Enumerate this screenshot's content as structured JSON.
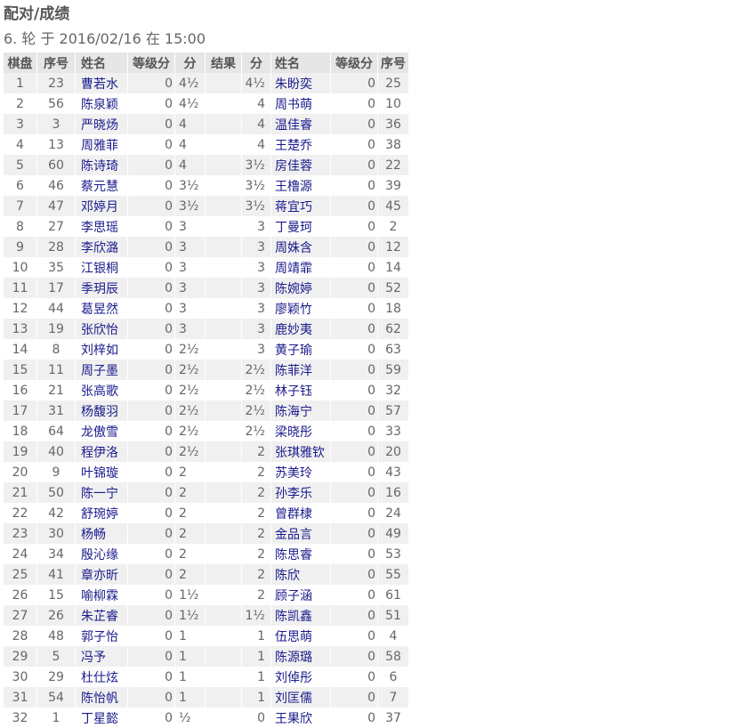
{
  "title": "配对/成绩",
  "round_info": "6. 轮 于 2016/02/16 在 15:00",
  "headers": {
    "board": "棋盘",
    "no1": "序号",
    "name1": "姓名",
    "rating1": "等级分",
    "pts1": "分",
    "result": "结果",
    "pts2": "分",
    "name2": "姓名",
    "rating2": "等级分",
    "no2": "序号"
  },
  "colors": {
    "header_bg": "#e6e6e6",
    "row_alt_bg": "#f0f0f0",
    "link": "#1a1a8c",
    "text": "#666666"
  },
  "rows": [
    {
      "board": "1",
      "no1": "23",
      "name1": "曹若水",
      "rating1": "0",
      "pts1": "4½",
      "result": "",
      "pts2": "4½",
      "name2": "朱盼奕",
      "rating2": "0",
      "no2": "25"
    },
    {
      "board": "2",
      "no1": "56",
      "name1": "陈泉颖",
      "rating1": "0",
      "pts1": "4½",
      "result": "",
      "pts2": "4",
      "name2": "周书萌",
      "rating2": "0",
      "no2": "10"
    },
    {
      "board": "3",
      "no1": "3",
      "name1": "严晓炀",
      "rating1": "0",
      "pts1": "4",
      "result": "",
      "pts2": "4",
      "name2": "温佳睿",
      "rating2": "0",
      "no2": "36"
    },
    {
      "board": "4",
      "no1": "13",
      "name1": "周雅菲",
      "rating1": "0",
      "pts1": "4",
      "result": "",
      "pts2": "4",
      "name2": "王楚乔",
      "rating2": "0",
      "no2": "38"
    },
    {
      "board": "5",
      "no1": "60",
      "name1": "陈诗琦",
      "rating1": "0",
      "pts1": "4",
      "result": "",
      "pts2": "3½",
      "name2": "房佳蓉",
      "rating2": "0",
      "no2": "22"
    },
    {
      "board": "6",
      "no1": "46",
      "name1": "蔡元慧",
      "rating1": "0",
      "pts1": "3½",
      "result": "",
      "pts2": "3½",
      "name2": "王橹源",
      "rating2": "0",
      "no2": "39"
    },
    {
      "board": "7",
      "no1": "47",
      "name1": "邓婷月",
      "rating1": "0",
      "pts1": "3½",
      "result": "",
      "pts2": "3½",
      "name2": "蒋宜巧",
      "rating2": "0",
      "no2": "45"
    },
    {
      "board": "8",
      "no1": "27",
      "name1": "李思瑶",
      "rating1": "0",
      "pts1": "3",
      "result": "",
      "pts2": "3",
      "name2": "丁曼珂",
      "rating2": "0",
      "no2": "2"
    },
    {
      "board": "9",
      "no1": "28",
      "name1": "李欣潞",
      "rating1": "0",
      "pts1": "3",
      "result": "",
      "pts2": "3",
      "name2": "周姝含",
      "rating2": "0",
      "no2": "12"
    },
    {
      "board": "10",
      "no1": "35",
      "name1": "江银桐",
      "rating1": "0",
      "pts1": "3",
      "result": "",
      "pts2": "3",
      "name2": "周靖霏",
      "rating2": "0",
      "no2": "14"
    },
    {
      "board": "11",
      "no1": "17",
      "name1": "季玥辰",
      "rating1": "0",
      "pts1": "3",
      "result": "",
      "pts2": "3",
      "name2": "陈婉婷",
      "rating2": "0",
      "no2": "52"
    },
    {
      "board": "12",
      "no1": "44",
      "name1": "葛昱然",
      "rating1": "0",
      "pts1": "3",
      "result": "",
      "pts2": "3",
      "name2": "廖颖竹",
      "rating2": "0",
      "no2": "18"
    },
    {
      "board": "13",
      "no1": "19",
      "name1": "张欣怡",
      "rating1": "0",
      "pts1": "3",
      "result": "",
      "pts2": "3",
      "name2": "鹿妙夷",
      "rating2": "0",
      "no2": "62"
    },
    {
      "board": "14",
      "no1": "8",
      "name1": "刘梓如",
      "rating1": "0",
      "pts1": "2½",
      "result": "",
      "pts2": "3",
      "name2": "黄子瑜",
      "rating2": "0",
      "no2": "63"
    },
    {
      "board": "15",
      "no1": "11",
      "name1": "周子墨",
      "rating1": "0",
      "pts1": "2½",
      "result": "",
      "pts2": "2½",
      "name2": "陈菲洋",
      "rating2": "0",
      "no2": "59"
    },
    {
      "board": "16",
      "no1": "21",
      "name1": "张高歌",
      "rating1": "0",
      "pts1": "2½",
      "result": "",
      "pts2": "2½",
      "name2": "林子钰",
      "rating2": "0",
      "no2": "32"
    },
    {
      "board": "17",
      "no1": "31",
      "name1": "杨馥羽",
      "rating1": "0",
      "pts1": "2½",
      "result": "",
      "pts2": "2½",
      "name2": "陈海宁",
      "rating2": "0",
      "no2": "57"
    },
    {
      "board": "18",
      "no1": "64",
      "name1": "龙傲雪",
      "rating1": "0",
      "pts1": "2½",
      "result": "",
      "pts2": "2½",
      "name2": "梁晓彤",
      "rating2": "0",
      "no2": "33"
    },
    {
      "board": "19",
      "no1": "40",
      "name1": "程伊洛",
      "rating1": "0",
      "pts1": "2½",
      "result": "",
      "pts2": "2",
      "name2": "张琪雅钦",
      "rating2": "0",
      "no2": "20"
    },
    {
      "board": "20",
      "no1": "9",
      "name1": "叶锦璇",
      "rating1": "0",
      "pts1": "2",
      "result": "",
      "pts2": "2",
      "name2": "苏美玲",
      "rating2": "0",
      "no2": "43"
    },
    {
      "board": "21",
      "no1": "50",
      "name1": "陈一宁",
      "rating1": "0",
      "pts1": "2",
      "result": "",
      "pts2": "2",
      "name2": "孙李乐",
      "rating2": "0",
      "no2": "16"
    },
    {
      "board": "22",
      "no1": "42",
      "name1": "舒琬婷",
      "rating1": "0",
      "pts1": "2",
      "result": "",
      "pts2": "2",
      "name2": "曾群棣",
      "rating2": "0",
      "no2": "24"
    },
    {
      "board": "23",
      "no1": "30",
      "name1": "杨畅",
      "rating1": "0",
      "pts1": "2",
      "result": "",
      "pts2": "2",
      "name2": "金品言",
      "rating2": "0",
      "no2": "49"
    },
    {
      "board": "24",
      "no1": "34",
      "name1": "殷沁缘",
      "rating1": "0",
      "pts1": "2",
      "result": "",
      "pts2": "2",
      "name2": "陈思睿",
      "rating2": "0",
      "no2": "53"
    },
    {
      "board": "25",
      "no1": "41",
      "name1": "章亦昕",
      "rating1": "0",
      "pts1": "2",
      "result": "",
      "pts2": "2",
      "name2": "陈欣",
      "rating2": "0",
      "no2": "55"
    },
    {
      "board": "26",
      "no1": "15",
      "name1": "喻柳霖",
      "rating1": "0",
      "pts1": "1½",
      "result": "",
      "pts2": "2",
      "name2": "顾子涵",
      "rating2": "0",
      "no2": "61"
    },
    {
      "board": "27",
      "no1": "26",
      "name1": "朱芷睿",
      "rating1": "0",
      "pts1": "1½",
      "result": "",
      "pts2": "1½",
      "name2": "陈凯鑫",
      "rating2": "0",
      "no2": "51"
    },
    {
      "board": "28",
      "no1": "48",
      "name1": "郭子怡",
      "rating1": "0",
      "pts1": "1",
      "result": "",
      "pts2": "1",
      "name2": "伍思萌",
      "rating2": "0",
      "no2": "4"
    },
    {
      "board": "29",
      "no1": "5",
      "name1": "冯予",
      "rating1": "0",
      "pts1": "1",
      "result": "",
      "pts2": "1",
      "name2": "陈源璐",
      "rating2": "0",
      "no2": "58"
    },
    {
      "board": "30",
      "no1": "29",
      "name1": "杜仕炫",
      "rating1": "0",
      "pts1": "1",
      "result": "",
      "pts2": "1",
      "name2": "刘倬彤",
      "rating2": "0",
      "no2": "6"
    },
    {
      "board": "31",
      "no1": "54",
      "name1": "陈怡帆",
      "rating1": "0",
      "pts1": "1",
      "result": "",
      "pts2": "1",
      "name2": "刘匡儒",
      "rating2": "0",
      "no2": "7"
    },
    {
      "board": "32",
      "no1": "1",
      "name1": "丁星懿",
      "rating1": "0",
      "pts1": "½",
      "result": "",
      "pts2": "0",
      "name2": "王果欣",
      "rating2": "0",
      "no2": "37"
    }
  ]
}
